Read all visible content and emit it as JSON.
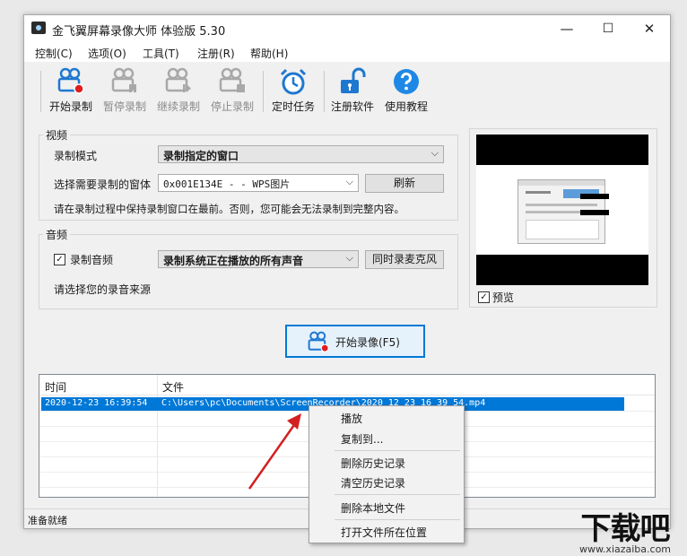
{
  "window": {
    "title": "金飞翼屏幕录像大师 体验版 5.30",
    "minimize": "—",
    "maximize": "☐",
    "close": "✕"
  },
  "menu": [
    "控制(C)",
    "选项(O)",
    "工具(T)",
    "注册(R)",
    "帮助(H)"
  ],
  "toolbar": {
    "start": "开始录制",
    "pause": "暂停录制",
    "resume": "继续录制",
    "stop": "停止录制",
    "schedule": "定时任务",
    "register": "注册软件",
    "tutorial": "使用教程"
  },
  "video": {
    "group_title": "视频",
    "mode_label": "录制模式",
    "mode_value": "录制指定的窗口",
    "window_label": "选择需要录制的窗体",
    "window_value": "0x001E134E - - WPS图片",
    "refresh": "刷新",
    "hint": "请在录制过程中保持录制窗口在最前。否则，您可能会无法录制到完整内容。"
  },
  "audio": {
    "group_title": "音频",
    "record_audio": "录制音频",
    "source_value": "录制系统正在播放的所有声音",
    "mic_button": "同时录麦克风",
    "hint": "请选择您的录音来源"
  },
  "preview": {
    "label": "预览"
  },
  "start_button": "开始录像(F5)",
  "list": {
    "col_time": "时间",
    "col_file": "文件",
    "rows": [
      {
        "time": "2020-12-23 16:39:54",
        "file": "C:\\Users\\pc\\Documents\\ScreenRecorder\\2020_12_23_16_39_54.mp4"
      }
    ]
  },
  "context_menu": {
    "play": "播放",
    "copy_to": "复制到...",
    "delete_history": "删除历史记录",
    "clear_history": "清空历史记录",
    "delete_local": "删除本地文件",
    "open_folder": "打开文件所在位置"
  },
  "status": "准备就绪",
  "watermark": {
    "text": "下载吧",
    "url": "www.xiazaiba.com"
  },
  "colors": {
    "accent": "#0078d7",
    "record_red": "#e01e1e",
    "arrow_red": "#d42020"
  }
}
